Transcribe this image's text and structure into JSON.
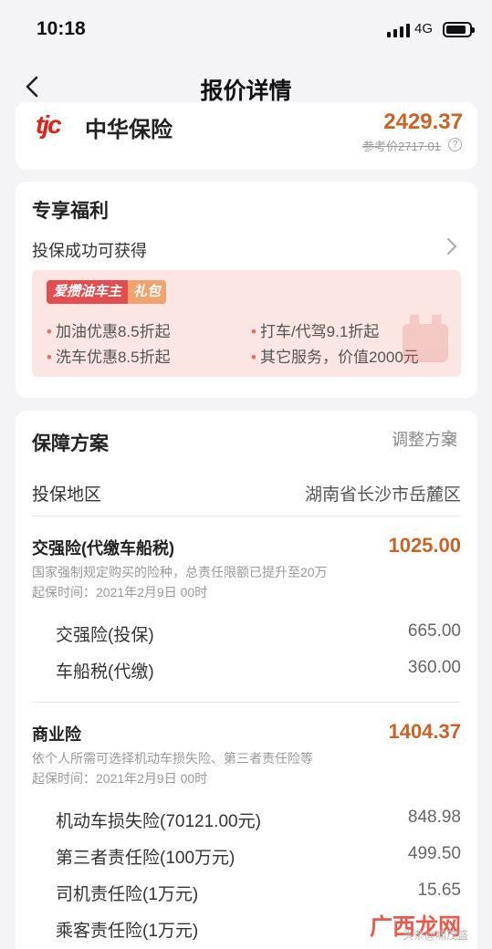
{
  "status": {
    "time": "10:18",
    "network": "4G"
  },
  "nav": {
    "title": "报价详情"
  },
  "insurer": {
    "logo_text": "tjc",
    "name": "中华保险",
    "price": "2429.37",
    "ref_price": "参考价2717.01",
    "help_symbol": "?"
  },
  "benefits": {
    "title": "专享福利",
    "subtitle": "投保成功可获得",
    "tag_main": "爱攒油车主",
    "tag_accent": "礼包",
    "items": [
      "加油优惠8.5折起",
      "打车/代驾9.1折起",
      "洗车优惠8.5折起",
      "其它服务，价值2000元"
    ]
  },
  "plan": {
    "title": "保障方案",
    "adjust_label": "调整方案",
    "region_label": "投保地区",
    "region_value": "湖南省长沙市岳麓区",
    "compulsory": {
      "title": "交强险(代缴车船税)",
      "amount": "1025.00",
      "desc": "国家强制规定购买的险种，总责任限额已提升至20万",
      "start": "起保时间：2021年2月9日 00时",
      "rows": [
        {
          "label": "交强险(投保)",
          "value": "665.00"
        },
        {
          "label": "车船税(代缴)",
          "value": "360.00"
        }
      ]
    },
    "commercial": {
      "title": "商业险",
      "amount": "1404.37",
      "desc": "依个人所需可选择机动车损失险、第三者责任险等",
      "start": "起保时间：2021年2月9日 00时",
      "rows": [
        {
          "label": "机动车损失险(70121.00元)",
          "value": "848.98"
        },
        {
          "label": "第三者责任险(100万元)",
          "value": "499.50"
        },
        {
          "label": "司机责任险(1万元)",
          "value": "15.65"
        },
        {
          "label": "乘客责任险(1万元)",
          "value": ""
        }
      ]
    }
  },
  "watermark": {
    "main": "广西龙网",
    "sub": "头条@啸茂盛"
  },
  "colors": {
    "accent": "#c96428",
    "brand_red": "#d7261e",
    "background": "#f4f4f6"
  }
}
